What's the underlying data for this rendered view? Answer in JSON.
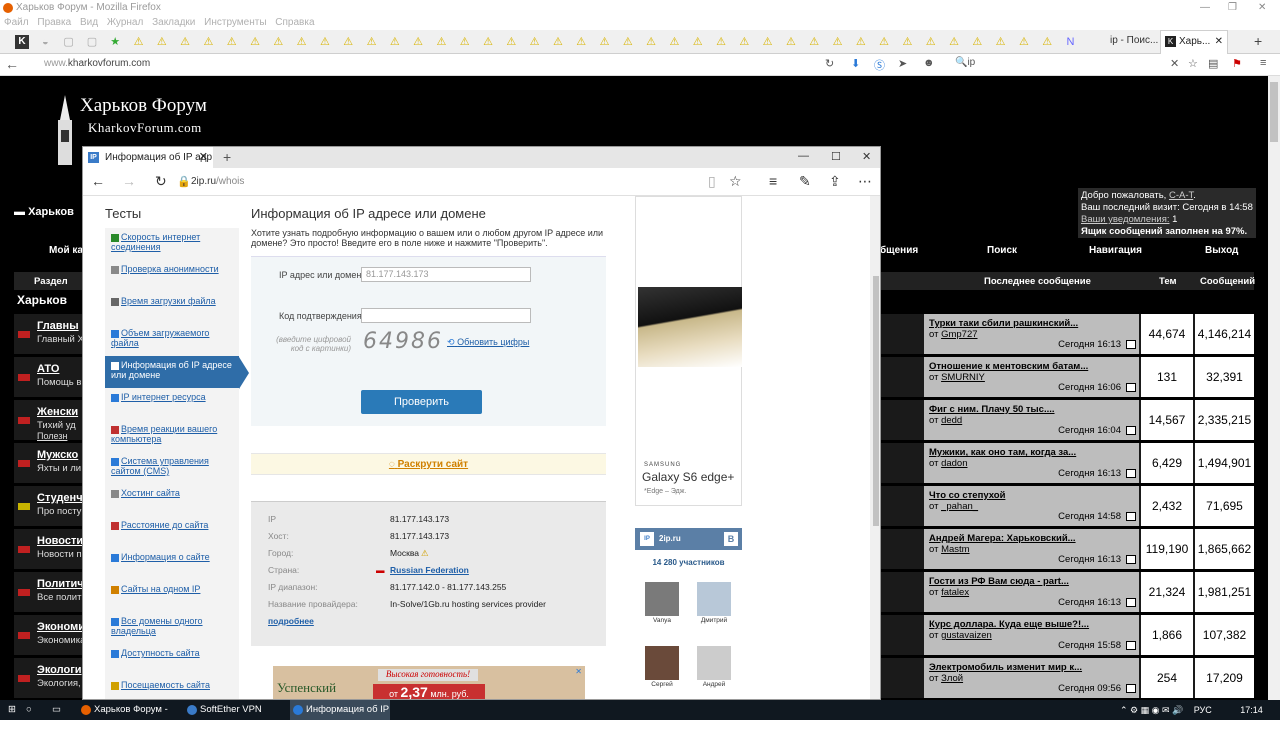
{
  "firefox": {
    "title": "Харьков Форум - Mozilla Firefox",
    "menu": [
      "Файл",
      "Правка",
      "Вид",
      "Журнал",
      "Закладки",
      "Инструменты",
      "Справка"
    ],
    "tab1_label": "ip - Поис...",
    "tab2_label": "Харь...",
    "url_prefix": "www.",
    "url_domain": "kharkovforum.com",
    "search_text": "ip"
  },
  "forum": {
    "logo_title": "Харьков Форум",
    "logo_sub": "KharkovForum.com",
    "section_label": "Харьков",
    "left_crumb": "Харьков",
    "welcome": {
      "line1_prefix": "Добро пожаловать,",
      "user": "C-A-T",
      "line2": "Ваш последний визит: Сегодня в 14:58",
      "notifications_label": "Ваши уведомления:",
      "notifications_count": "1",
      "mailbox": "Ящик сообщений заполнен на 97%."
    },
    "nav": {
      "my_profile": "Мой каб",
      "messages": "бщения",
      "search": "Поиск",
      "navigation": "Навигация",
      "logout": "Выход"
    },
    "table_headers": {
      "section": "Раздел",
      "last_post": "Последнее сообщение",
      "topics": "Тем",
      "posts": "Сообщений"
    },
    "rows": [
      {
        "name": "Главны",
        "desc": "Главный Х",
        "icon": "red",
        "last_title": "Турки таки сбили рашкинский...",
        "last_by_prefix": "от",
        "last_by": "Gmp727",
        "last_date": "Сегодня 16:13",
        "topics": "44,674",
        "posts": "4,146,214"
      },
      {
        "name": "АТО",
        "desc": "Помощь в",
        "icon": "red",
        "last_title": "Отношение к ментовским батам...",
        "last_by_prefix": "от",
        "last_by": "SMURNIY",
        "last_date": "Сегодня 16:06",
        "topics": "131",
        "posts": "32,391"
      },
      {
        "name": "Женски",
        "desc": "Тихий уд",
        "icon": "red",
        "last_title": "Фиг с ним. Плачу 50 тыс....",
        "last_by_prefix": "от",
        "last_by": "dedd",
        "last_date": "Сегодня 16:04",
        "topics": "14,567",
        "posts": "2,335,215"
      },
      {
        "name": "Мужско",
        "desc": "Яхты и ли",
        "icon": "red",
        "last_title": "Мужики, как оно там, когда за...",
        "last_by_prefix": "от",
        "last_by": "dadon",
        "last_date": "Сегодня 16:13",
        "topics": "6,429",
        "posts": "1,494,901"
      },
      {
        "name": "Студенч",
        "desc": "Про посту",
        "icon": "yellow",
        "last_title": "Что со степухой",
        "last_by_prefix": "от",
        "last_by": "_pahan_",
        "last_date": "Сегодня 14:58",
        "topics": "2,432",
        "posts": "71,695"
      },
      {
        "name": "Новости",
        "desc": "Новости п",
        "icon": "red",
        "last_title": "Андрей Магера: Харьковский...",
        "last_by_prefix": "от",
        "last_by": "Mastm",
        "last_date": "Сегодня 16:13",
        "topics": "119,190",
        "posts": "1,865,662"
      },
      {
        "name": "Политич",
        "desc": "Все полит",
        "icon": "red",
        "last_title": "Гости из РФ Вам сюда - part...",
        "last_by_prefix": "от",
        "last_by": "fatalex",
        "last_date": "Сегодня 16:13",
        "topics": "21,324",
        "posts": "1,981,251"
      },
      {
        "name": "Экономи",
        "desc": "Экономика",
        "icon": "red",
        "last_title": "Курс доллара. Куда еще выше?!...",
        "last_by_prefix": "от",
        "last_by": "gustavaizen",
        "last_date": "Сегодня 15:58",
        "topics": "1,866",
        "posts": "107,382"
      },
      {
        "name": "Экологи",
        "desc": "Экология,",
        "icon": "red",
        "last_title": "Электромобиль изменит мир к...",
        "last_by_prefix": "от",
        "last_by": "Злой",
        "last_date": "Сегодня 09:56",
        "topics": "254",
        "posts": "17,209"
      }
    ],
    "subforum_link": "Полезн"
  },
  "edge": {
    "tab_title": "Информация об IP адр",
    "url_domain": "2ip.ru",
    "url_path": "/whois"
  },
  "site": {
    "sidebar_title": "Тесты",
    "sidebar": [
      {
        "label": "Скорость интернет соединения",
        "active": false
      },
      {
        "label": "Проверка анонимности",
        "active": false
      },
      {
        "label": "Время загрузки файла",
        "active": false
      },
      {
        "label": "Объем загружаемого файла",
        "active": false
      },
      {
        "label": "Информация об IP адресе или домене",
        "active": true
      },
      {
        "label": "IP интернет ресурса",
        "active": false
      },
      {
        "label": "Время реакции вашего компьютера",
        "active": false
      },
      {
        "label": "Система управления сайтом (CMS)",
        "active": false
      },
      {
        "label": "Хостинг сайта",
        "active": false
      },
      {
        "label": "Расстояние до сайта",
        "active": false
      },
      {
        "label": "Информация о сайте",
        "active": false
      },
      {
        "label": "Сайты на одном IP",
        "active": false
      },
      {
        "label": "Все домены одного владельца",
        "active": false
      },
      {
        "label": "Доступность сайта",
        "active": false
      },
      {
        "label": "Посещаемость сайта",
        "active": false
      }
    ],
    "main_title": "Информация об IP адресе или домене",
    "main_desc": "Хотите узнать подробную информацию о вашем или о любом другом IP адресе или домене? Это просто! Введите его в поле ниже и нажмите \"Проверить\".",
    "ip_label": "IP адрес или домен:",
    "ip_placeholder": "81.177.143.173",
    "code_label": "Код подтверждения:",
    "code_hint": "(введите цифровой код с картинки)",
    "captcha": "64986",
    "refresh": "Обновить цифры",
    "check_button": "Проверить",
    "promo": "Раскрути сайт",
    "info": [
      {
        "key": "IP",
        "value": "81.177.143.173"
      },
      {
        "key": "Хост:",
        "value": "81.177.143.173"
      },
      {
        "key": "Город:",
        "value": "Москва"
      },
      {
        "key": "Страна:",
        "value": "Russian Federation"
      },
      {
        "key": "IP диапазон:",
        "value": "81.177.142.0 - 81.177.143.255"
      },
      {
        "key": "Название провайдера:",
        "value": "In-Solve/1Gb.ru hosting services provider"
      }
    ],
    "more_link": "подробнее",
    "ad": {
      "brand": "SAMSUNG",
      "model": "Galaxy S6 edge+",
      "subline": "*Edge – Эдж."
    },
    "vk": {
      "site": "2ip.ru",
      "members": "14 280 участников",
      "people": [
        "Vanya",
        "Дмитрий",
        "Сергей",
        "Андрей"
      ]
    },
    "bottom_ad": {
      "brand": "Успенский",
      "headline": "Высокая готовность!",
      "price_prefix": "от",
      "price": "2,37",
      "price_suffix": "млн. руб."
    }
  },
  "taskbar": {
    "items": [
      "Харьков Форум - Мо...",
      "SoftEther VPN Client ...",
      "Информация об IP а..."
    ],
    "lang": "РУС",
    "time": "17:14"
  }
}
